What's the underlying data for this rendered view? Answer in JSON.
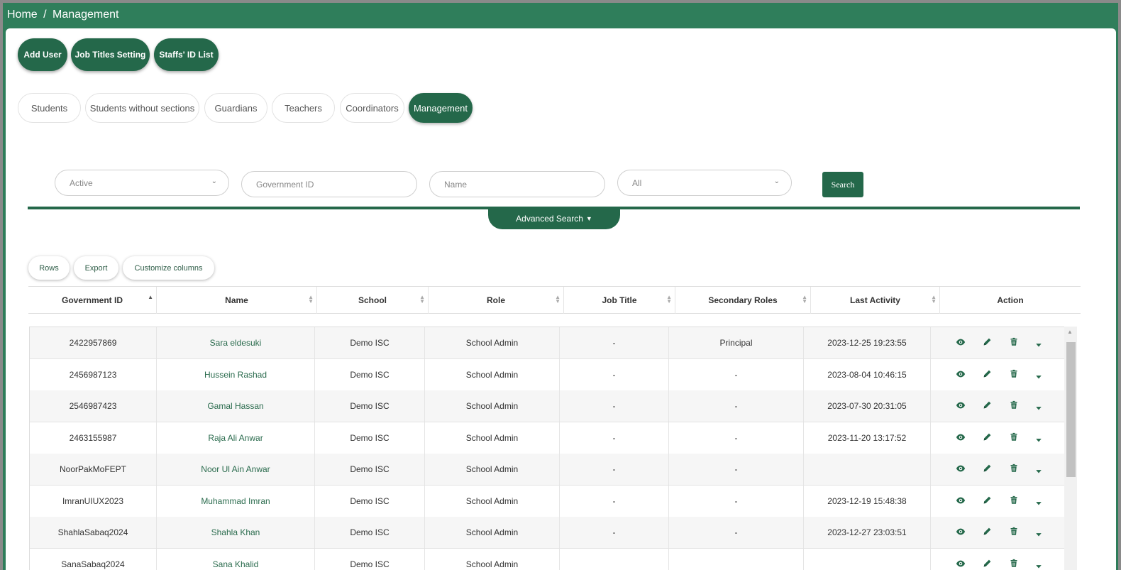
{
  "breadcrumb": {
    "home": "Home",
    "sep": "/",
    "current": "Management"
  },
  "action_buttons": {
    "add_user": "Add User",
    "job_titles": "Job Titles Setting",
    "staff_ids": "Staffs' ID List"
  },
  "tabs": [
    "Students",
    "Students without sections",
    "Guardians",
    "Teachers",
    "Coordinators",
    "Management"
  ],
  "active_tab": "Management",
  "filters": {
    "status_value": "Active",
    "government_id_placeholder": "Government ID",
    "name_placeholder": "Name",
    "school_value": "All",
    "search_label": "Search",
    "advanced_label": "Advanced Search"
  },
  "table_tools": {
    "rows": "Rows",
    "export": "Export",
    "customize": "Customize columns"
  },
  "columns": [
    "Government ID",
    "Name",
    "School",
    "Role",
    "Job Title",
    "Secondary Roles",
    "Last Activity",
    "Action"
  ],
  "rows": [
    {
      "gov_id": "2422957869",
      "name": "Sara eldesuki",
      "school": "Demo ISC",
      "role": "School Admin",
      "job_title": "-",
      "secondary": "Principal",
      "last_activity": "2023-12-25 19:23:55"
    },
    {
      "gov_id": "2456987123",
      "name": "Hussein Rashad",
      "school": "Demo ISC",
      "role": "School Admin",
      "job_title": "-",
      "secondary": "-",
      "last_activity": "2023-08-04 10:46:15"
    },
    {
      "gov_id": "2546987423",
      "name": "Gamal Hassan",
      "school": "Demo ISC",
      "role": "School Admin",
      "job_title": "-",
      "secondary": "-",
      "last_activity": "2023-07-30 20:31:05"
    },
    {
      "gov_id": "2463155987",
      "name": "Raja Ali Anwar",
      "school": "Demo ISC",
      "role": "School Admin",
      "job_title": "-",
      "secondary": "-",
      "last_activity": "2023-11-20 13:17:52"
    },
    {
      "gov_id": "NoorPakMoFEPT",
      "name": "Noor Ul Ain Anwar",
      "school": "Demo ISC",
      "role": "School Admin",
      "job_title": "-",
      "secondary": "-",
      "last_activity": ""
    },
    {
      "gov_id": "ImranUIUX2023",
      "name": "Muhammad Imran",
      "school": "Demo ISC",
      "role": "School Admin",
      "job_title": "-",
      "secondary": "-",
      "last_activity": "2023-12-19 15:48:38"
    },
    {
      "gov_id": "ShahlaSabaq2024",
      "name": "Shahla Khan",
      "school": "Demo ISC",
      "role": "School Admin",
      "job_title": "-",
      "secondary": "-",
      "last_activity": "2023-12-27 23:03:51"
    },
    {
      "gov_id": "SanaSabaq2024",
      "name": "Sana Khalid",
      "school": "Demo ISC",
      "role": "School Admin",
      "job_title": "",
      "secondary": "",
      "last_activity": ""
    }
  ],
  "colors": {
    "primary": "#24684a",
    "header_bg": "#2f7e5b",
    "link": "#2a6b4d"
  },
  "row_actions": [
    "eye-icon",
    "pencil-icon",
    "trash-icon",
    "caret-down-icon"
  ]
}
